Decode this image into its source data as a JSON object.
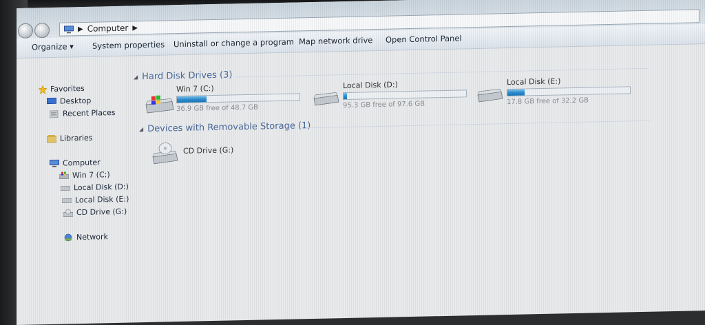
{
  "address": {
    "crumbs": [
      "Computer"
    ]
  },
  "toolbar": {
    "organize": "Organize ▾",
    "system_properties": "System properties",
    "uninstall": "Uninstall or change a program",
    "map_drive": "Map network drive",
    "control_panel": "Open Control Panel"
  },
  "nav": {
    "favorites": "Favorites",
    "desktop": "Desktop",
    "recent": "Recent Places",
    "libraries": "Libraries",
    "computer": "Computer",
    "drive_c": "Win 7 (C:)",
    "drive_d": "Local Disk (D:)",
    "drive_e": "Local Disk (E:)",
    "drive_g": "CD Drive (G:)",
    "network": "Network"
  },
  "groups": {
    "hdd": "Hard Disk Drives (3)",
    "removable": "Devices with Removable Storage (1)"
  },
  "drives": [
    {
      "name": "Win 7 (C:)",
      "free_text": "36.9 GB free of 48.7 GB",
      "used_fraction": 0.24
    },
    {
      "name": "Local Disk (D:)",
      "free_text": "95.3 GB free of 97.6 GB",
      "used_fraction": 0.03
    },
    {
      "name": "Local Disk (E:)",
      "free_text": "17.8 GB free of 32.2 GB",
      "used_fraction": 0.14
    }
  ],
  "cd": {
    "name": "CD Drive (G:)"
  }
}
